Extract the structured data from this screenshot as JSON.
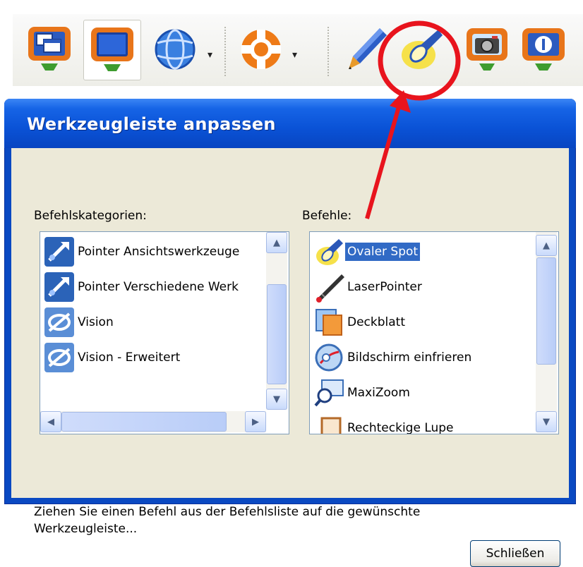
{
  "toolbar": {
    "buttons": [
      {
        "icon": "window-monitor-icon"
      },
      {
        "icon": "monitor-icon"
      },
      {
        "icon": "globe-dropdown-icon"
      },
      {
        "icon": "lifebuoy-dropdown-icon"
      },
      {
        "icon": "pen-icon"
      },
      {
        "icon": "spotlight-flashlight-icon"
      },
      {
        "icon": "camera-icon"
      },
      {
        "icon": "info-monitor-icon"
      }
    ]
  },
  "dialog": {
    "title": "Werkzeugleiste anpassen",
    "categories": {
      "label": "Befehlskategorien:",
      "items": [
        {
          "label": "Pointer Ansichtswerkzeuge",
          "icon": "pointer-icon",
          "selected": false
        },
        {
          "label": "Pointer Verschiedene Werk",
          "icon": "pointer-icon",
          "selected": false
        },
        {
          "label": "Vision",
          "icon": "vision-icon",
          "selected": false
        },
        {
          "label": "Vision - Erweitert",
          "icon": "vision-icon",
          "selected": false
        }
      ]
    },
    "commands": {
      "label": "Befehle:",
      "items": [
        {
          "label": "Ovaler Spot",
          "icon": "flashlight-icon",
          "selected": true
        },
        {
          "label": "LaserPointer",
          "icon": "laser-pointer-icon",
          "selected": false
        },
        {
          "label": "Deckblatt",
          "icon": "cover-sheet-icon",
          "selected": false
        },
        {
          "label": "Bildschirm einfrieren",
          "icon": "freeze-screen-icon",
          "selected": false
        },
        {
          "label": "MaxiZoom",
          "icon": "magnifier-icon",
          "selected": false
        },
        {
          "label": "Rechteckige Lupe",
          "icon": "rect-magnifier-icon",
          "selected": false
        }
      ]
    },
    "hint": "Ziehen Sie einen Befehl aus der Befehlsliste auf die gewünschte Werkzeugleiste...",
    "close_label": "Schließen"
  },
  "colors": {
    "titlebar": "#0a52d6",
    "selection": "#316ac5",
    "annotation": "#e8141d",
    "dialog_bg": "#ece9d8"
  }
}
